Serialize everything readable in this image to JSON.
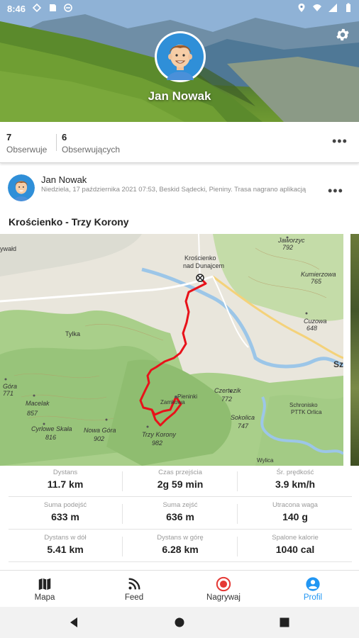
{
  "status_bar": {
    "time": "8:46",
    "icons_left": [
      "data-saver-icon",
      "sd-card-icon",
      "vpn-icon"
    ],
    "icons_right": [
      "location-icon",
      "wifi-icon",
      "signal-icon",
      "battery-icon"
    ]
  },
  "profile": {
    "name": "Jan Nowak",
    "following_count": "7",
    "following_label": "Obserwuje",
    "followers_count": "6",
    "followers_label": "Obserwujących"
  },
  "post": {
    "author": "Jan Nowak",
    "meta": "Niedziela, 17 października 2021 07:53, Beskid Sądecki, Pieniny. Trasa nagrano aplikacją",
    "title": "Krościenko - Trzy Korony",
    "map_labels": {
      "town": "Krościenko",
      "town2": "nad Dunajcem",
      "jaworzyc": "Jaworzyc",
      "jaworzyc_h": "792",
      "kozlecki": "ywałd",
      "kiczera": "Kumierzowa",
      "kiczera_h": "765",
      "tylka": "Tylka",
      "cuzowa": "Cuzowa",
      "cuzowa_h": "648",
      "gora1": "Góra",
      "gora1_h": "771",
      "macelak": "Macelak",
      "macelak_h": "857",
      "cyrlowe": "Cyrlowe Skała",
      "cyrlowe_h": "816",
      "nowa": "Nowa Góra",
      "nowa_h": "902",
      "trzy": "Trzy Korony",
      "trzy_h": "982",
      "czerteza": "Czertezik",
      "czerteza_h": "772",
      "sokolica": "Sokolica",
      "sokolica_h": "747",
      "schronisko": "Schronisko",
      "schronisko2": "PTTK Orlica",
      "zamkowa": "Zamkowa",
      "pieninki": "Pieninki",
      "sz": "Sz",
      "wylica": "Wylica"
    },
    "stats": [
      {
        "label": "Dystans",
        "value": "11.7 km"
      },
      {
        "label": "Czas przejścia",
        "value": "2g 59 min"
      },
      {
        "label": "Śr. prędkość",
        "value": "3.9 km/h"
      },
      {
        "label": "Suma podejść",
        "value": "633 m"
      },
      {
        "label": "Suma zejść",
        "value": "636 m"
      },
      {
        "label": "Utracona waga",
        "value": "140 g"
      },
      {
        "label": "Dystans w dół",
        "value": "5.41 km"
      },
      {
        "label": "Dystans w górę",
        "value": "6.28 km"
      },
      {
        "label": "Spalone kalorie",
        "value": "1040 cal"
      }
    ]
  },
  "nav": {
    "items": [
      {
        "label": "Mapa",
        "icon": "map-icon"
      },
      {
        "label": "Feed",
        "icon": "rss-feed-icon"
      },
      {
        "label": "Nagrywaj",
        "icon": "record-icon"
      },
      {
        "label": "Profil",
        "icon": "profile-icon"
      }
    ],
    "active": "Profil"
  },
  "colors": {
    "accent": "#2196f3",
    "record": "#e53935",
    "route": "#e8121a"
  }
}
